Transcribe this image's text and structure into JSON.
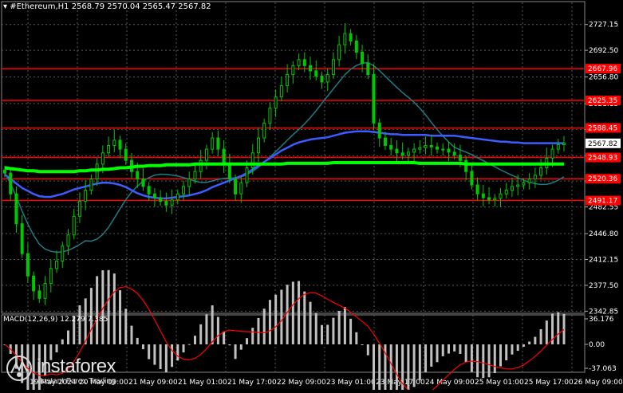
{
  "header": {
    "symbol": "#Ethereum,H1",
    "ohlc": "2568.79 2570.04 2565.47 2567.82"
  },
  "macd": {
    "label": "MACD(12,26,9) 12.279 7.385"
  },
  "logo": {
    "name": "instaforex",
    "tagline": "Instant Forex Trading"
  },
  "current_price": "2567.82",
  "colors": {
    "background": "#000000",
    "candle": "#00c800",
    "level_line": "#ff0000",
    "level_label_bg": "#ff0000",
    "ma_fast": "#00ff00",
    "ma_blue": "#3c5cff",
    "ma_teal": "#1e7c86",
    "macd_hist": "#c0c0c0",
    "macd_signal": "#ff0000"
  },
  "chart_data": {
    "type": "candlestick",
    "price_axis": [
      "2727.15",
      "2692.50",
      "2656.80",
      "2621.15",
      "2586.50",
      "2550.85",
      "2517.20",
      "2482.55",
      "2446.80",
      "2412.15",
      "2377.50",
      "2342.85"
    ],
    "ylim": [
      2340,
      2745
    ],
    "time_axis": [
      "19 May 2024",
      "20 May 09:00",
      "21 May 09:00",
      "21 May 01:00",
      "21 May 17:00",
      "22 May 09:00",
      "23 May 01:00",
      "23 May 17:00",
      "24 May 09:00",
      "25 May 01:00",
      "25 May 17:00",
      "26 May 09:00"
    ],
    "levels": [
      {
        "value": 2667.96,
        "label": "2667.96"
      },
      {
        "value": 2625.35,
        "label": "2625.35"
      },
      {
        "value": 2588.45,
        "label": "2588.45"
      },
      {
        "value": 2548.93,
        "label": "2548.93"
      },
      {
        "value": 2520.36,
        "label": "2520.36"
      },
      {
        "value": 2491.17,
        "label": "2491.17"
      }
    ],
    "close": [
      2528,
      2500,
      2460,
      2420,
      2390,
      2370,
      2360,
      2380,
      2400,
      2410,
      2430,
      2445,
      2470,
      2490,
      2505,
      2520,
      2540,
      2555,
      2565,
      2572,
      2560,
      2545,
      2530,
      2520,
      2510,
      2500,
      2495,
      2490,
      2485,
      2492,
      2500,
      2510,
      2520,
      2530,
      2545,
      2560,
      2575,
      2560,
      2540,
      2520,
      2500,
      2515,
      2535,
      2555,
      2575,
      2595,
      2615,
      2630,
      2645,
      2660,
      2672,
      2680,
      2672,
      2665,
      2658,
      2650,
      2660,
      2680,
      2700,
      2715,
      2705,
      2690,
      2675,
      2660,
      2595,
      2575,
      2565,
      2560,
      2555,
      2552,
      2556,
      2560,
      2562,
      2565,
      2563,
      2560,
      2560,
      2556,
      2552,
      2545,
      2530,
      2512,
      2500,
      2495,
      2492,
      2494,
      2500,
      2505,
      2510,
      2512,
      2515,
      2520,
      2525,
      2535,
      2548,
      2560,
      2566,
      2567.82
    ],
    "ma_green": [
      2535,
      2534,
      2533,
      2532,
      2531,
      2531,
      2530,
      2530,
      2530,
      2530,
      2530,
      2530,
      2530,
      2531,
      2531,
      2532,
      2532,
      2533,
      2533,
      2534,
      2535,
      2535,
      2536,
      2537,
      2537,
      2538,
      2538,
      2538,
      2539,
      2539,
      2539,
      2539,
      2539,
      2540,
      2540,
      2540,
      2540,
      2540,
      2540,
      2540,
      2540,
      2540,
      2540,
      2540,
      2540,
      2540,
      2540,
      2540,
      2540,
      2541,
      2541,
      2541,
      2541,
      2541,
      2541,
      2541,
      2541,
      2542,
      2542,
      2542,
      2542,
      2542,
      2542,
      2542,
      2542,
      2542,
      2542,
      2542,
      2542,
      2542,
      2542,
      2542,
      2541,
      2541,
      2541,
      2541,
      2541,
      2541,
      2541,
      2541,
      2540,
      2540,
      2540,
      2540,
      2540,
      2540,
      2540,
      2540,
      2540,
      2540,
      2540,
      2540,
      2540,
      2540,
      2540,
      2540,
      2540,
      2540
    ],
    "ma_blue": [
      2526,
      2520,
      2514,
      2508,
      2504,
      2500,
      2497,
      2496,
      2496,
      2498,
      2500,
      2503,
      2506,
      2508,
      2510,
      2512,
      2514,
      2515,
      2515,
      2514,
      2512,
      2509,
      2505,
      2501,
      2498,
      2496,
      2495,
      2494,
      2494,
      2495,
      2496,
      2497,
      2498,
      2500,
      2502,
      2505,
      2509,
      2512,
      2515,
      2518,
      2521,
      2524,
      2528,
      2533,
      2538,
      2543,
      2548,
      2553,
      2558,
      2562,
      2566,
      2569,
      2571,
      2573,
      2574,
      2575,
      2576,
      2578,
      2580,
      2582,
      2583,
      2584,
      2584,
      2584,
      2583,
      2582,
      2581,
      2580,
      2580,
      2579,
      2579,
      2579,
      2579,
      2579,
      2578,
      2578,
      2578,
      2578,
      2578,
      2577,
      2576,
      2575,
      2574,
      2573,
      2572,
      2571,
      2570,
      2570,
      2569,
      2569,
      2568,
      2568,
      2568,
      2568,
      2568,
      2568,
      2568,
      2568
    ]
  }
}
